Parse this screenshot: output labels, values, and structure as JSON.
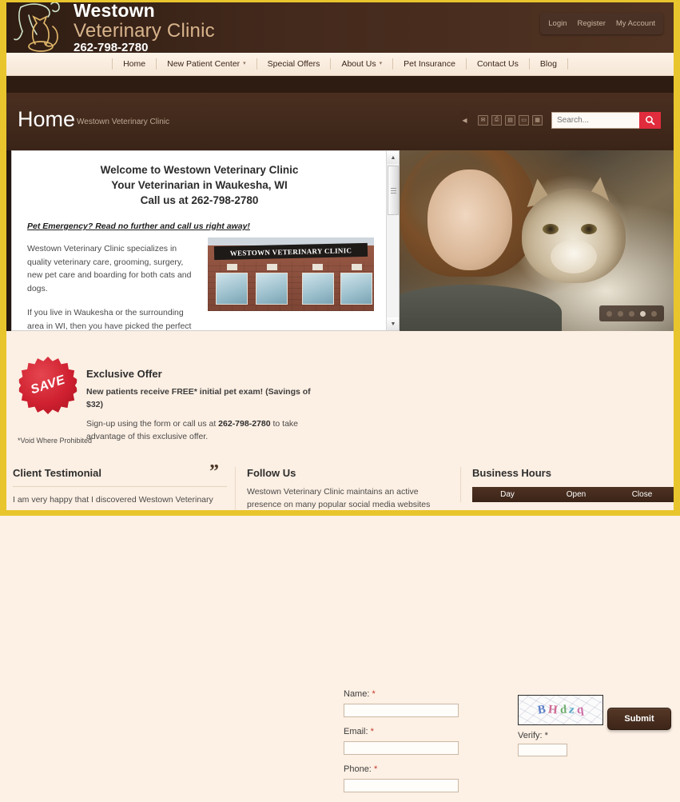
{
  "header": {
    "brand_line1": "Westown",
    "brand_line2": "Veterinary Clinic",
    "phone": "262-798-2780",
    "logo_icon": "dog-cat-line-art-logo",
    "account_links": [
      {
        "label": "Login",
        "name": "login-link"
      },
      {
        "label": "Register",
        "name": "register-link"
      },
      {
        "label": "My Account",
        "name": "my-account-link"
      }
    ]
  },
  "nav": {
    "items": [
      {
        "label": "Home",
        "has_caret": false
      },
      {
        "label": "New Patient Center",
        "has_caret": true
      },
      {
        "label": "Special Offers",
        "has_caret": false
      },
      {
        "label": "About Us",
        "has_caret": true
      },
      {
        "label": "Pet Insurance",
        "has_caret": false
      },
      {
        "label": "Contact Us",
        "has_caret": false
      },
      {
        "label": "Blog",
        "has_caret": false
      }
    ],
    "caret_glyph": "▾"
  },
  "titlebar": {
    "title": "Home",
    "subtitle": "Westown Veterinary Clinic",
    "collapse_glyph": "◀",
    "tool_icons": [
      {
        "name": "email-page-icon",
        "glyph": "✉"
      },
      {
        "name": "print-page-icon",
        "glyph": "⎙"
      },
      {
        "name": "bookmark-page-icon",
        "glyph": "▤"
      },
      {
        "name": "share-page-icon",
        "glyph": "▭"
      },
      {
        "name": "calendar-icon",
        "glyph": "▦"
      }
    ],
    "search": {
      "placeholder": "Search...",
      "value": "",
      "button_icon": "search-magnifier-icon"
    }
  },
  "content": {
    "heading_line1": "Welcome to Westown Veterinary Clinic",
    "heading_line2": "Your Veterinarian in Waukesha, WI",
    "heading_line3": "Call us at 262-798-2780",
    "emergency_note": "Pet Emergency? Read no further and call us right away!",
    "paragraph1": "Westown Veterinary Clinic specializes in quality veterinary care, grooming, surgery, new pet care and boarding for both cats and dogs.",
    "paragraph2": "If you live in Waukesha or the surrounding area in WI, then you have picked the perfect site to find a veterinarian. Dr. Tanvir",
    "building_sign": "WESTOWN VETERINARY CLINIC",
    "scroll_up_glyph": "▲",
    "scroll_down_glyph": "▼"
  },
  "hero": {
    "image_alt": "girl-holding-tabby-cat-photo",
    "slide_count": 5,
    "active_slide": 4
  },
  "offer": {
    "badge_text": "SAVE",
    "heading": "Exclusive Offer",
    "line1": "New patients receive FREE* initial pet exam! (Savings of $32)",
    "line2_prefix": "Sign-up using the form or call us at ",
    "line2_phone": "262-798-2780",
    "line2_suffix": " to take advantage of this exclusive offer.",
    "void_note": "*Void Where Prohibited"
  },
  "form": {
    "fields": [
      {
        "label": "Name:",
        "required": "*",
        "value": "",
        "name": "name-field"
      },
      {
        "label": "Email:",
        "required": "*",
        "value": "",
        "name": "email-field"
      },
      {
        "label": "Phone:",
        "required": "*",
        "value": "",
        "name": "phone-field"
      }
    ],
    "captcha_chars": [
      "B",
      "H",
      "d",
      "z",
      "q"
    ],
    "verify_label": "Verify:",
    "verify_required": "*",
    "verify_value": "",
    "submit_label": "Submit"
  },
  "bottom": {
    "testimonial": {
      "heading": "Client Testimonial",
      "quote_glyph": "”",
      "text": "I am very happy that I discovered Westown Veterinary"
    },
    "follow": {
      "heading": "Follow Us",
      "text": "Westown Veterinary Clinic maintains an active presence on many popular social media websites"
    },
    "hours": {
      "heading": "Business Hours",
      "columns": [
        "Day",
        "Open",
        "Close"
      ]
    }
  },
  "colors": {
    "frame_yellow": "#e8c52d",
    "header_brown": "#3a2419",
    "accent_red": "#e02c3c",
    "body_cream": "#fcefe3"
  }
}
